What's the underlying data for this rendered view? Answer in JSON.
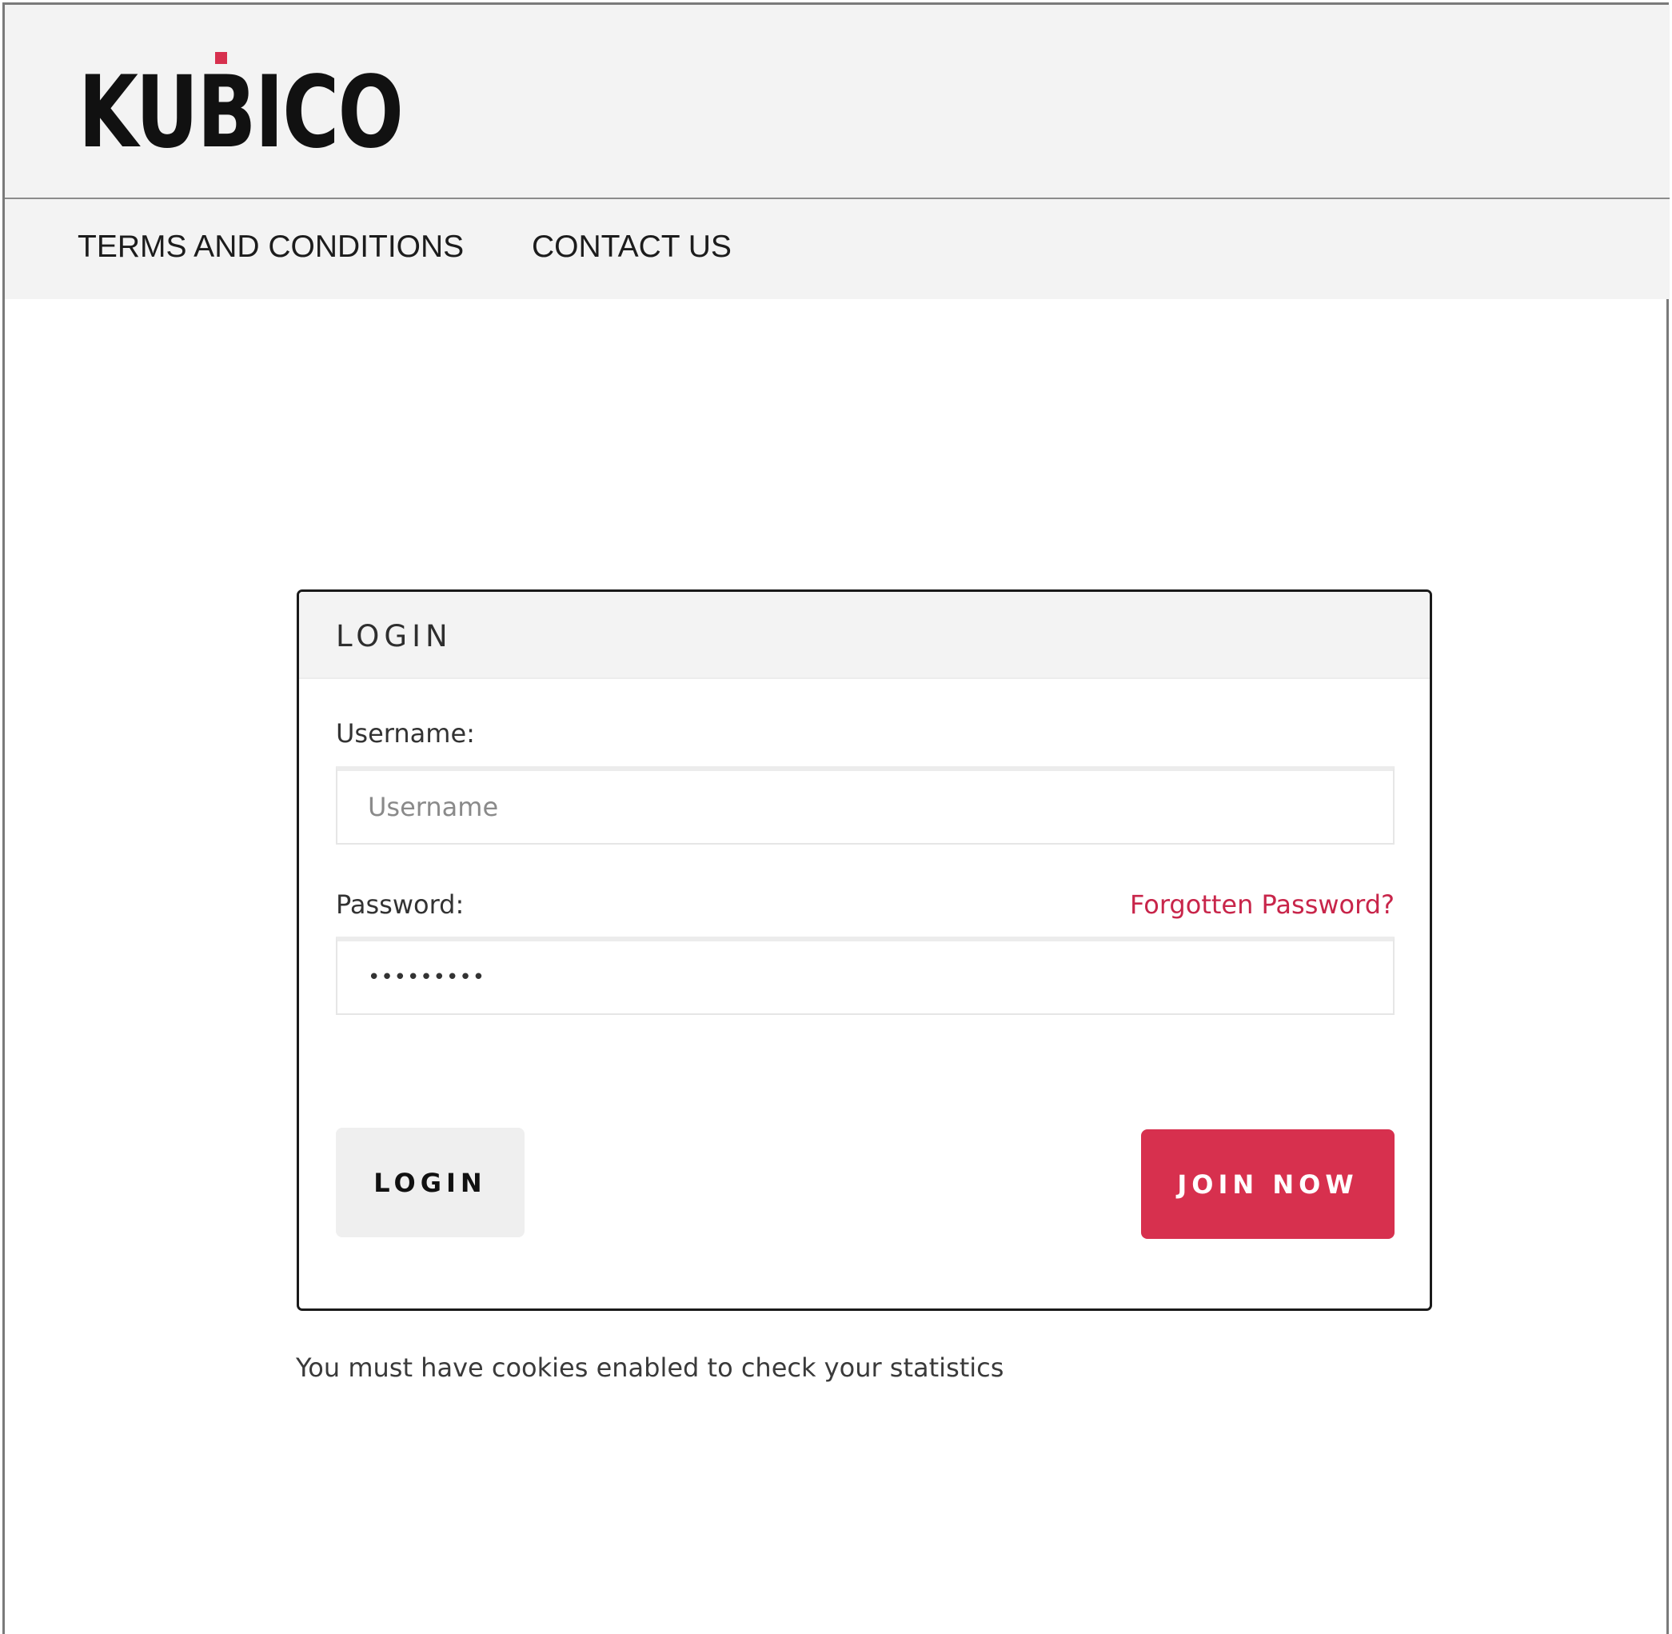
{
  "brand": {
    "logo_text": "KUBICO",
    "accent_color": "#d7304e"
  },
  "nav": {
    "items": [
      {
        "label": "TERMS AND CONDITIONS"
      },
      {
        "label": "CONTACT US"
      }
    ]
  },
  "login_panel": {
    "title": "LOGIN",
    "username_label": "Username:",
    "username_placeholder": "Username",
    "username_value": "",
    "password_label": "Password:",
    "password_value": "•••••••••",
    "forgot_password_link": "Forgotten Password?",
    "login_button": "LOGIN",
    "join_button": "JOIN NOW"
  },
  "cookie_notice": "You must have cookies enabled to check your statistics"
}
